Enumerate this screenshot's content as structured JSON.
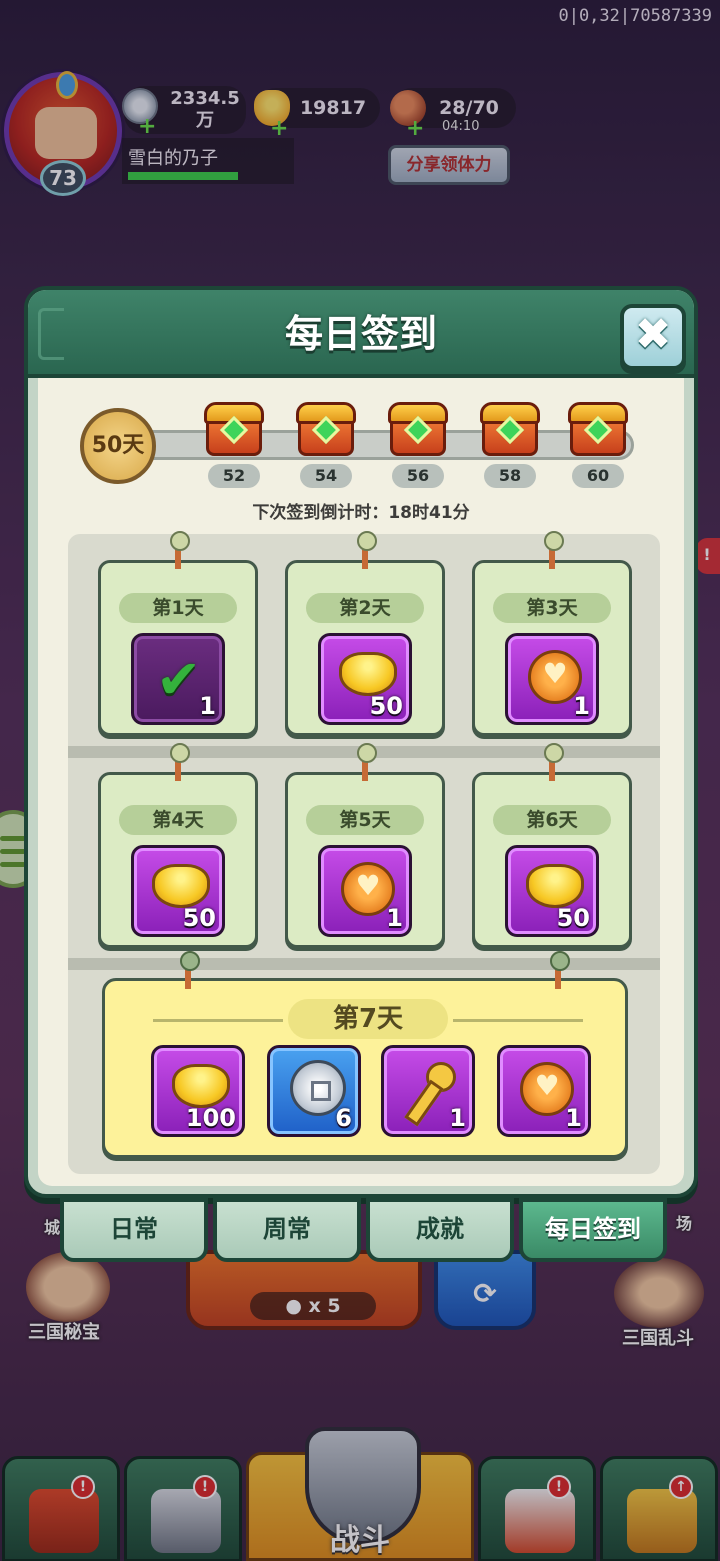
{
  "debug_coords": "0|0,32|70587339",
  "player": {
    "level": "73",
    "name": "雪白的乃子"
  },
  "resources": {
    "silver": "2334.5万",
    "gold": "19817",
    "stamina": "28/70",
    "stamina_timer": "04:10",
    "share_label": "分享领体力"
  },
  "background": {
    "side_alert": "!",
    "kingdom_left": "三国秘宝",
    "kingdom_right": "三国乱斗",
    "left_edge_text": "城",
    "right_edge_text": "场",
    "battle_cost": "x 5",
    "refresh_symbol": "⟳"
  },
  "dialog": {
    "title": "每日签到",
    "close_symbol": "✖",
    "progress": {
      "days": "50天",
      "milestones": [
        "52",
        "54",
        "56",
        "58",
        "60"
      ]
    },
    "countdown": "下次签到倒计时：18时41分",
    "days": [
      {
        "label": "第1天",
        "reward": "check",
        "qty": "1",
        "claimed": true
      },
      {
        "label": "第2天",
        "reward": "ingot",
        "qty": "50",
        "claimed": false
      },
      {
        "label": "第3天",
        "reward": "medal",
        "qty": "1",
        "claimed": false
      },
      {
        "label": "第4天",
        "reward": "ingot",
        "qty": "50",
        "claimed": false
      },
      {
        "label": "第5天",
        "reward": "medal",
        "qty": "1",
        "claimed": false
      },
      {
        "label": "第6天",
        "reward": "ingot",
        "qty": "50",
        "claimed": false
      }
    ],
    "day7": {
      "label": "第7天",
      "rewards": [
        {
          "reward": "ingot",
          "qty": "100"
        },
        {
          "reward": "silver-coin",
          "qty": "6"
        },
        {
          "reward": "key",
          "qty": "1"
        },
        {
          "reward": "medal",
          "qty": "1"
        }
      ]
    }
  },
  "tabs": [
    {
      "label": "日常",
      "active": false
    },
    {
      "label": "周常",
      "active": false
    },
    {
      "label": "成就",
      "active": false
    },
    {
      "label": "每日签到",
      "active": true
    }
  ],
  "bottom_nav": {
    "battle_label": "战斗",
    "badge_alert": "!",
    "badge_up": "↑"
  },
  "colors": {
    "dialog_header": "#3f8369",
    "item_purple": "#b43fdc",
    "item_blue": "#3b86e0",
    "day7_bg": "#fdf29a"
  }
}
